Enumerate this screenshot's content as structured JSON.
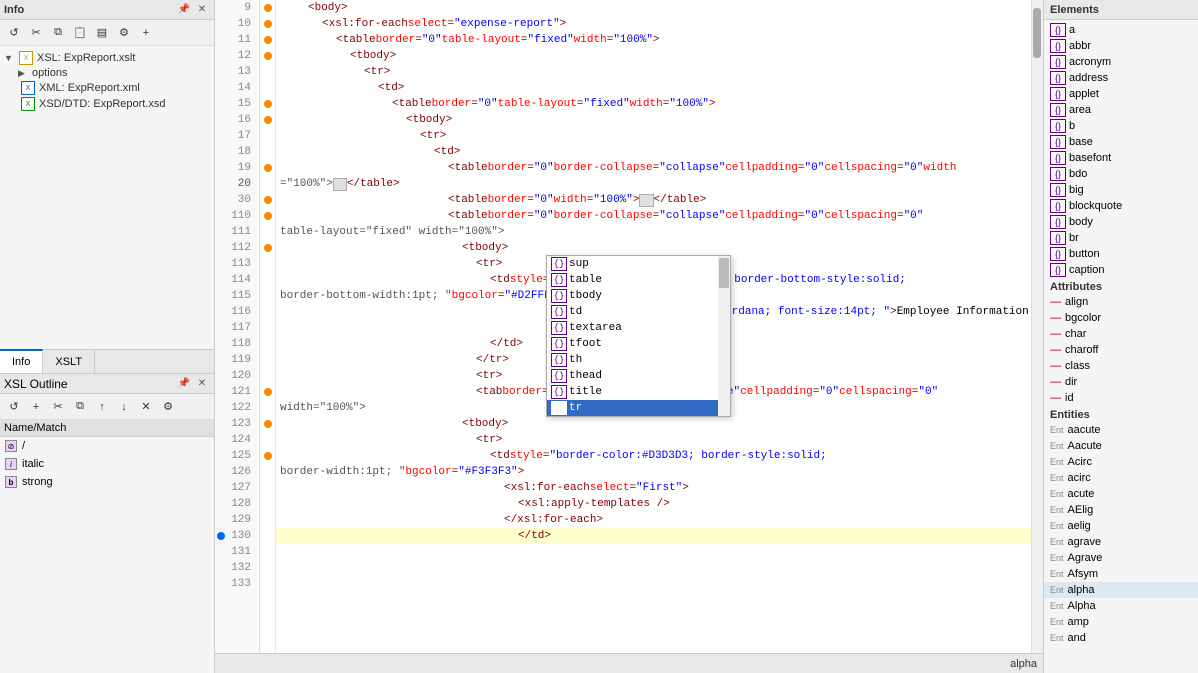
{
  "leftPanel": {
    "infoHeader": "Info",
    "pinIcon": "📌",
    "closeIcon": "✕",
    "treeItems": [
      {
        "type": "xsl",
        "label": "XSL: ExpReport.xslt",
        "expanded": true
      },
      {
        "type": "options",
        "label": "options",
        "indent": 1
      },
      {
        "type": "xml",
        "label": "XML: ExpReport.xml",
        "indent": 1
      },
      {
        "type": "xsd",
        "label": "XSD/DTD: ExpReport.xsd",
        "indent": 1
      }
    ],
    "tabs": [
      {
        "id": "info",
        "label": "Info"
      },
      {
        "id": "xslt",
        "label": "XSLT"
      }
    ],
    "activeTab": "info"
  },
  "xslOutline": {
    "title": "XSL Outline",
    "columnHeader": "Name/Match",
    "items": [
      {
        "icon": "slash",
        "label": "/"
      },
      {
        "icon": "italic",
        "label": "italic"
      },
      {
        "icon": "strong",
        "label": "strong"
      }
    ]
  },
  "editor": {
    "lines": [
      {
        "num": 9,
        "hasDot": false,
        "content": "<body>",
        "indentLevel": 2
      },
      {
        "num": 10,
        "hasDot": false,
        "content": "<xsl:for-each select=\"expense-report\">",
        "indentLevel": 3
      },
      {
        "num": 11,
        "hasDot": false,
        "content": "<table border=\"0\" table-layout=\"fixed\" width=\"100%\">",
        "indentLevel": 4
      },
      {
        "num": 12,
        "hasDot": false,
        "content": "<tbody>",
        "indentLevel": 5
      },
      {
        "num": 13,
        "hasDot": false,
        "content": "<tr>",
        "indentLevel": 6
      },
      {
        "num": 14,
        "hasDot": false,
        "content": "<td>",
        "indentLevel": 7
      },
      {
        "num": 15,
        "hasDot": false,
        "content": "<table border=\"0\" table-layout=\"fixed\" width=\"100%\">",
        "indentLevel": 8
      },
      {
        "num": 16,
        "hasDot": false,
        "content": "<tbody>",
        "indentLevel": 9
      },
      {
        "num": 17,
        "hasDot": false,
        "content": "<tr>",
        "indentLevel": 10
      },
      {
        "num": 18,
        "hasDot": false,
        "content": "<td>",
        "indentLevel": 11
      },
      {
        "num": 19,
        "hasDot": false,
        "content": "<table border=\"0\" border-collapse=\"collapse\" cellpadding=\"0\" cellspacing=\"0\" width",
        "indentLevel": 12
      },
      {
        "num": 20,
        "hasDot": false,
        "content": "",
        "indentLevel": 0,
        "continuation": "=\"100%\"></table>"
      },
      {
        "num": 30,
        "hasDot": false,
        "content": "<table border=\"0\" width=\"100%\"></table>",
        "indentLevel": 12
      },
      {
        "num": 110,
        "hasDot": false,
        "content": "<table border=\"0\" border-collapse=\"collapse\" cellpadding=\"0\" cellspacing=\"0\"",
        "indentLevel": 12
      },
      {
        "num": 111,
        "hasDot": false,
        "content": "",
        "indentLevel": 0,
        "continuation2": "table-layout=\"fixed\" width=\"100%\">"
      },
      {
        "num": 112,
        "hasDot": false,
        "content": "<tbody>",
        "indentLevel": 13
      },
      {
        "num": 113,
        "hasDot": false,
        "content": "<tr>",
        "indentLevel": 14
      },
      {
        "num": 114,
        "hasDot": false,
        "content": "",
        "indentLevel": 0,
        "specialLine": "<td style=\"border-bottom-color:black; border-bottom-style:solid;"
      },
      {
        "num": 115,
        "hasDot": false,
        "content": "",
        "specialLineCont": "border-bottom-width:1pt; \" bgcolor=\"#D2FFFF\">"
      },
      {
        "num": 116,
        "hasDot": false,
        "content": "",
        "spanLine": "<span style=\"font-family:Verdana; font-size:14pt; \">Employee Information"
      },
      {
        "num": 117,
        "hasDot": false,
        "content": "</td>",
        "indentLevel": 14
      },
      {
        "num": 118,
        "hasDot": false,
        "content": "</tr>",
        "indentLevel": 13
      },
      {
        "num": 119,
        "hasDot": false,
        "content": "<tr>",
        "indentLevel": 13
      },
      {
        "num": 120,
        "hasDot": false,
        "content": "</tr>",
        "indentLevel": 13
      },
      {
        "num": 121,
        "hasDot": false,
        "content": "",
        "fullLine": "<tab border=\"0\" border-collapse=\"collapse\" cellpadding=\"0\" cellspacing=\"0\""
      },
      {
        "num": 122,
        "hasDot": false,
        "content": "",
        "fullLineCont": "width=\"100%\">"
      },
      {
        "num": 123,
        "hasDot": false,
        "content": "<tbody>",
        "indentLevel": 13
      },
      {
        "num": 124,
        "hasDot": false,
        "content": "<tr>",
        "indentLevel": 14
      },
      {
        "num": 125,
        "hasDot": false,
        "content": "<td style=\"border-color:#D3D3D3; border-style:solid;",
        "indentLevel": 14
      },
      {
        "num": 126,
        "hasDot": false,
        "content": "",
        "borderCont": "border-width:1pt; \" bgcolor=\"#F3F3F3\">"
      },
      {
        "num": 127,
        "hasDot": false,
        "content": "<xsl:for-each select=\"First\">",
        "indentLevel": 15
      },
      {
        "num": 128,
        "hasDot": false,
        "content": "<xsl:apply-templates />",
        "indentLevel": 16
      },
      {
        "num": 129,
        "hasDot": false,
        "content": "</xsl:for-each>",
        "indentLevel": 15
      },
      {
        "num": 130,
        "hasDot": true,
        "dotBlue": true,
        "content": "",
        "indentLevel": 0
      },
      {
        "num": 131,
        "hasDot": false,
        "content": "",
        "indentLevel": 0
      },
      {
        "num": 132,
        "hasDot": false,
        "content": "",
        "indentLevel": 0
      },
      {
        "num": 133,
        "hasDot": false,
        "content": "",
        "indentLevel": 0
      }
    ]
  },
  "autocomplete": {
    "visible": true,
    "items": [
      {
        "label": "sup",
        "selected": false
      },
      {
        "label": "table",
        "selected": false
      },
      {
        "label": "tbody",
        "selected": false
      },
      {
        "label": "td",
        "selected": false
      },
      {
        "label": "textarea",
        "selected": false
      },
      {
        "label": "tfoot",
        "selected": false
      },
      {
        "label": "th",
        "selected": false
      },
      {
        "label": "thead",
        "selected": false
      },
      {
        "label": "title",
        "selected": false
      },
      {
        "label": "tr",
        "selected": true
      }
    ]
  },
  "rightPanel": {
    "title": "Elements",
    "elements": [
      "a",
      "abbr",
      "acronym",
      "address",
      "applet",
      "area",
      "b",
      "base",
      "basefont",
      "bdo",
      "big",
      "blockquote",
      "body",
      "br",
      "button",
      "caption"
    ],
    "attributes": {
      "title": "Attributes",
      "items": [
        "align",
        "bgcolor",
        "char",
        "charoff",
        "class",
        "dir",
        "id"
      ]
    },
    "entities": {
      "title": "Entities",
      "items": [
        "aacute",
        "Aacute",
        "Acirc",
        "acirc",
        "acute",
        "AElig",
        "aelig",
        "agrave",
        "Agrave",
        "Afsym",
        "alpha",
        "Alpha",
        "amp",
        "and"
      ]
    }
  },
  "bottomBar": {
    "alpha": "alpha"
  }
}
